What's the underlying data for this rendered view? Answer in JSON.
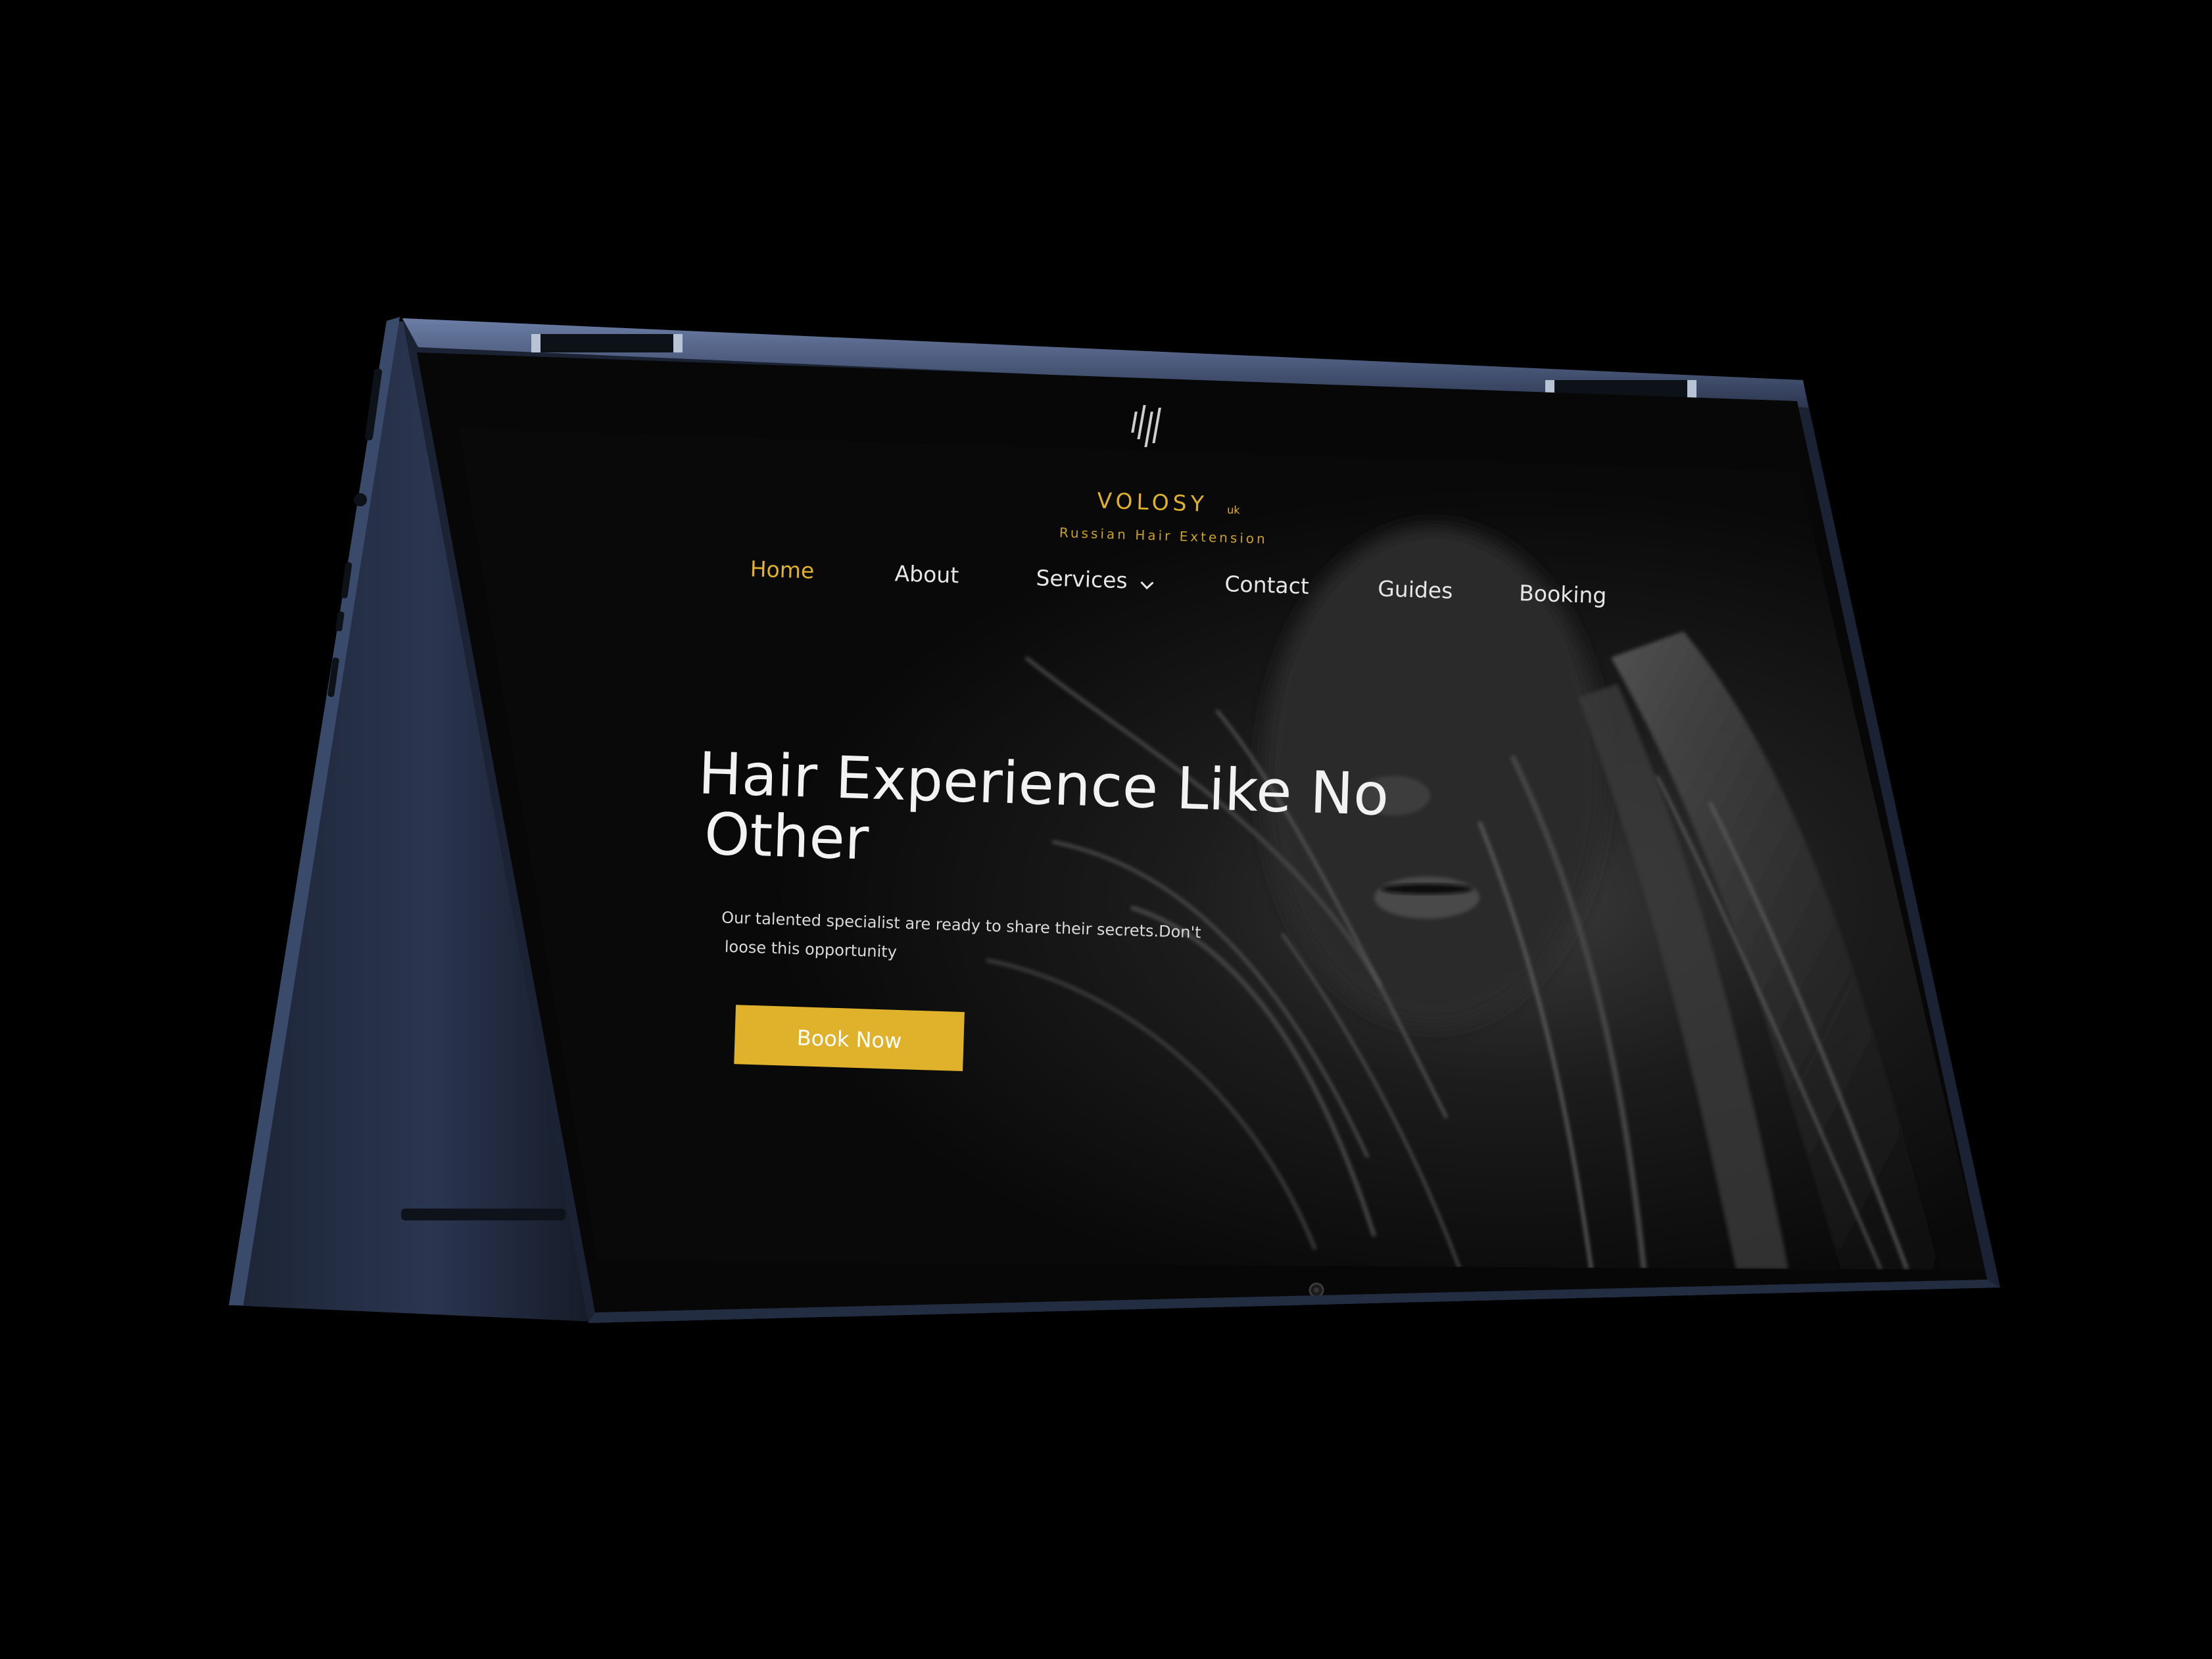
{
  "device": {
    "brand_logo_icon": "hp-logo-icon",
    "camera_icon": "webcam-icon"
  },
  "site": {
    "logo": {
      "name": "VOLOSY",
      "suffix": "uk",
      "tagline": "Russian Hair Extension"
    },
    "nav": {
      "items": [
        {
          "label": "Home",
          "active": true
        },
        {
          "label": "About",
          "active": false
        },
        {
          "label": "Services",
          "active": false,
          "has_dropdown": true,
          "dropdown_icon": "chevron-down-icon"
        },
        {
          "label": "Contact",
          "active": false
        },
        {
          "label": "Guides",
          "active": false
        },
        {
          "label": "Booking",
          "active": false
        }
      ]
    },
    "hero": {
      "title_line1": "Hair Experience Like No",
      "title_line2": "Other",
      "subtitle_line1": "Our talented specialist are ready to share their secrets.Don't",
      "subtitle_line2": "loose this opportunity",
      "cta_label": "Book Now"
    }
  },
  "colors": {
    "accent": "#e0b12a",
    "nav_text": "#e6e6e6",
    "hero_text": "#f2f2f2",
    "background": "#0b0b0b",
    "device_body": "#1e2738"
  }
}
